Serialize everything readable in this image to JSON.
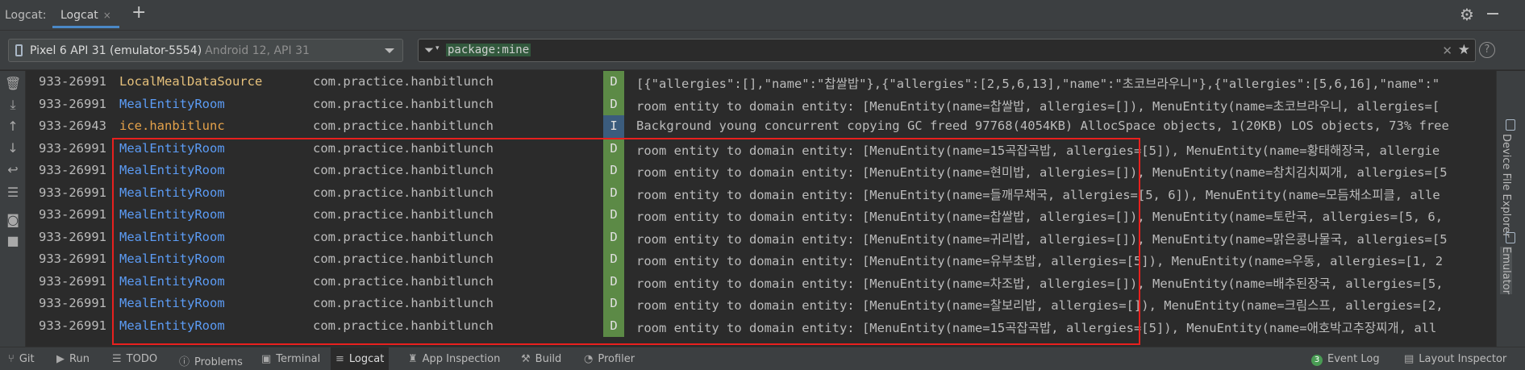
{
  "header": {
    "tool_title": "Logcat:",
    "tab_label": "Logcat",
    "tab_close": "×",
    "add_tab": "+"
  },
  "filter": {
    "device_name": "Pixel 6 API 31 (emulator-5554)",
    "device_sub": "Android 12, API 31",
    "query": "package:mine",
    "clear": "✕",
    "favorite": "★",
    "help": "?"
  },
  "colors": {
    "tag_blue": "#5c9cf5",
    "tag_orange": "#e5a24a",
    "debug_green": "#5c8a46",
    "info_blue": "#3b5c7d",
    "highlight_red": "#e8201e"
  },
  "log_rows": [
    {
      "pid": "933-26991",
      "tag": "LocalMealDataSource",
      "tag_color": "#e5c07b",
      "pkg": "com.practice.hanbitlunch",
      "level": "D",
      "level_color": "#5c8a46",
      "msg": "[{\"allergies\":[],\"name\":\"찹쌀밥\"},{\"allergies\":[2,5,6,13],\"name\":\"초코브라우니\"},{\"allergies\":[5,6,16],\"name\":\""
    },
    {
      "pid": "933-26991",
      "tag": "MealEntityRoom",
      "tag_color": "#5c9cf5",
      "pkg": "com.practice.hanbitlunch",
      "level": "D",
      "level_color": "#5c8a46",
      "msg": "room entity to domain entity: [MenuEntity(name=찹쌀밥, allergies=[]), MenuEntity(name=초코브라우니, allergies=["
    },
    {
      "pid": "933-26943",
      "tag": "ice.hanbitlunc",
      "tag_color": "#e5a24a",
      "pkg": "com.practice.hanbitlunch",
      "level": "I",
      "level_color": "#3b5c7d",
      "msg": "Background young concurrent copying GC freed 97768(4054KB) AllocSpace objects, 1(20KB) LOS objects, 73% free"
    },
    {
      "pid": "933-26991",
      "tag": "MealEntityRoom",
      "tag_color": "#5c9cf5",
      "pkg": "com.practice.hanbitlunch",
      "level": "D",
      "level_color": "#5c8a46",
      "msg": "room entity to domain entity: [MenuEntity(name=15곡잡곡밥, allergies=[5]), MenuEntity(name=황태해장국, allergie"
    },
    {
      "pid": "933-26991",
      "tag": "MealEntityRoom",
      "tag_color": "#5c9cf5",
      "pkg": "com.practice.hanbitlunch",
      "level": "D",
      "level_color": "#5c8a46",
      "msg": "room entity to domain entity: [MenuEntity(name=현미밥, allergies=[]), MenuEntity(name=참치김치찌개, allergies=[5"
    },
    {
      "pid": "933-26991",
      "tag": "MealEntityRoom",
      "tag_color": "#5c9cf5",
      "pkg": "com.practice.hanbitlunch",
      "level": "D",
      "level_color": "#5c8a46",
      "msg": "room entity to domain entity: [MenuEntity(name=들깨무채국, allergies=[5, 6]), MenuEntity(name=모듬채소피클, alle"
    },
    {
      "pid": "933-26991",
      "tag": "MealEntityRoom",
      "tag_color": "#5c9cf5",
      "pkg": "com.practice.hanbitlunch",
      "level": "D",
      "level_color": "#5c8a46",
      "msg": "room entity to domain entity: [MenuEntity(name=찹쌀밥, allergies=[]), MenuEntity(name=토란국, allergies=[5, 6,"
    },
    {
      "pid": "933-26991",
      "tag": "MealEntityRoom",
      "tag_color": "#5c9cf5",
      "pkg": "com.practice.hanbitlunch",
      "level": "D",
      "level_color": "#5c8a46",
      "msg": "room entity to domain entity: [MenuEntity(name=귀리밥, allergies=[]), MenuEntity(name=맑은콩나물국, allergies=[5"
    },
    {
      "pid": "933-26991",
      "tag": "MealEntityRoom",
      "tag_color": "#5c9cf5",
      "pkg": "com.practice.hanbitlunch",
      "level": "D",
      "level_color": "#5c8a46",
      "msg": "room entity to domain entity: [MenuEntity(name=유부초밥, allergies=[5]), MenuEntity(name=우동, allergies=[1, 2"
    },
    {
      "pid": "933-26991",
      "tag": "MealEntityRoom",
      "tag_color": "#5c9cf5",
      "pkg": "com.practice.hanbitlunch",
      "level": "D",
      "level_color": "#5c8a46",
      "msg": "room entity to domain entity: [MenuEntity(name=차조밥, allergies=[]), MenuEntity(name=배추된장국, allergies=[5,"
    },
    {
      "pid": "933-26991",
      "tag": "MealEntityRoom",
      "tag_color": "#5c9cf5",
      "pkg": "com.practice.hanbitlunch",
      "level": "D",
      "level_color": "#5c8a46",
      "msg": "room entity to domain entity: [MenuEntity(name=찰보리밥, allergies=[]), MenuEntity(name=크림스프, allergies=[2,"
    },
    {
      "pid": "933-26991",
      "tag": "MealEntityRoom",
      "tag_color": "#5c9cf5",
      "pkg": "com.practice.hanbitlunch",
      "level": "D",
      "level_color": "#5c8a46",
      "msg": "room entity to domain entity: [MenuEntity(name=15곡잡곡밥, allergies=[5]), MenuEntity(name=애호박고추장찌개, all"
    }
  ],
  "right_tools": [
    {
      "label": "Device File Explorer",
      "icon": "folder-device-icon"
    },
    {
      "label": "Emulator",
      "icon": "emulator-icon"
    }
  ],
  "left_tools": [
    "trash-icon",
    "scroll-to-end-icon",
    "up-arrow-icon",
    "down-arrow-icon",
    "soft-wrap-icon",
    "filter-settings-icon",
    "screenshot-icon",
    "screen-record-icon"
  ],
  "status": {
    "git": "Git",
    "run": "Run",
    "todo": "TODO",
    "problems": "Problems",
    "terminal": "Terminal",
    "logcat": "Logcat",
    "app_inspection": "App Inspection",
    "build": "Build",
    "profiler": "Profiler",
    "event_log": "Event Log",
    "event_count": "3",
    "layout_inspector": "Layout Inspector"
  }
}
